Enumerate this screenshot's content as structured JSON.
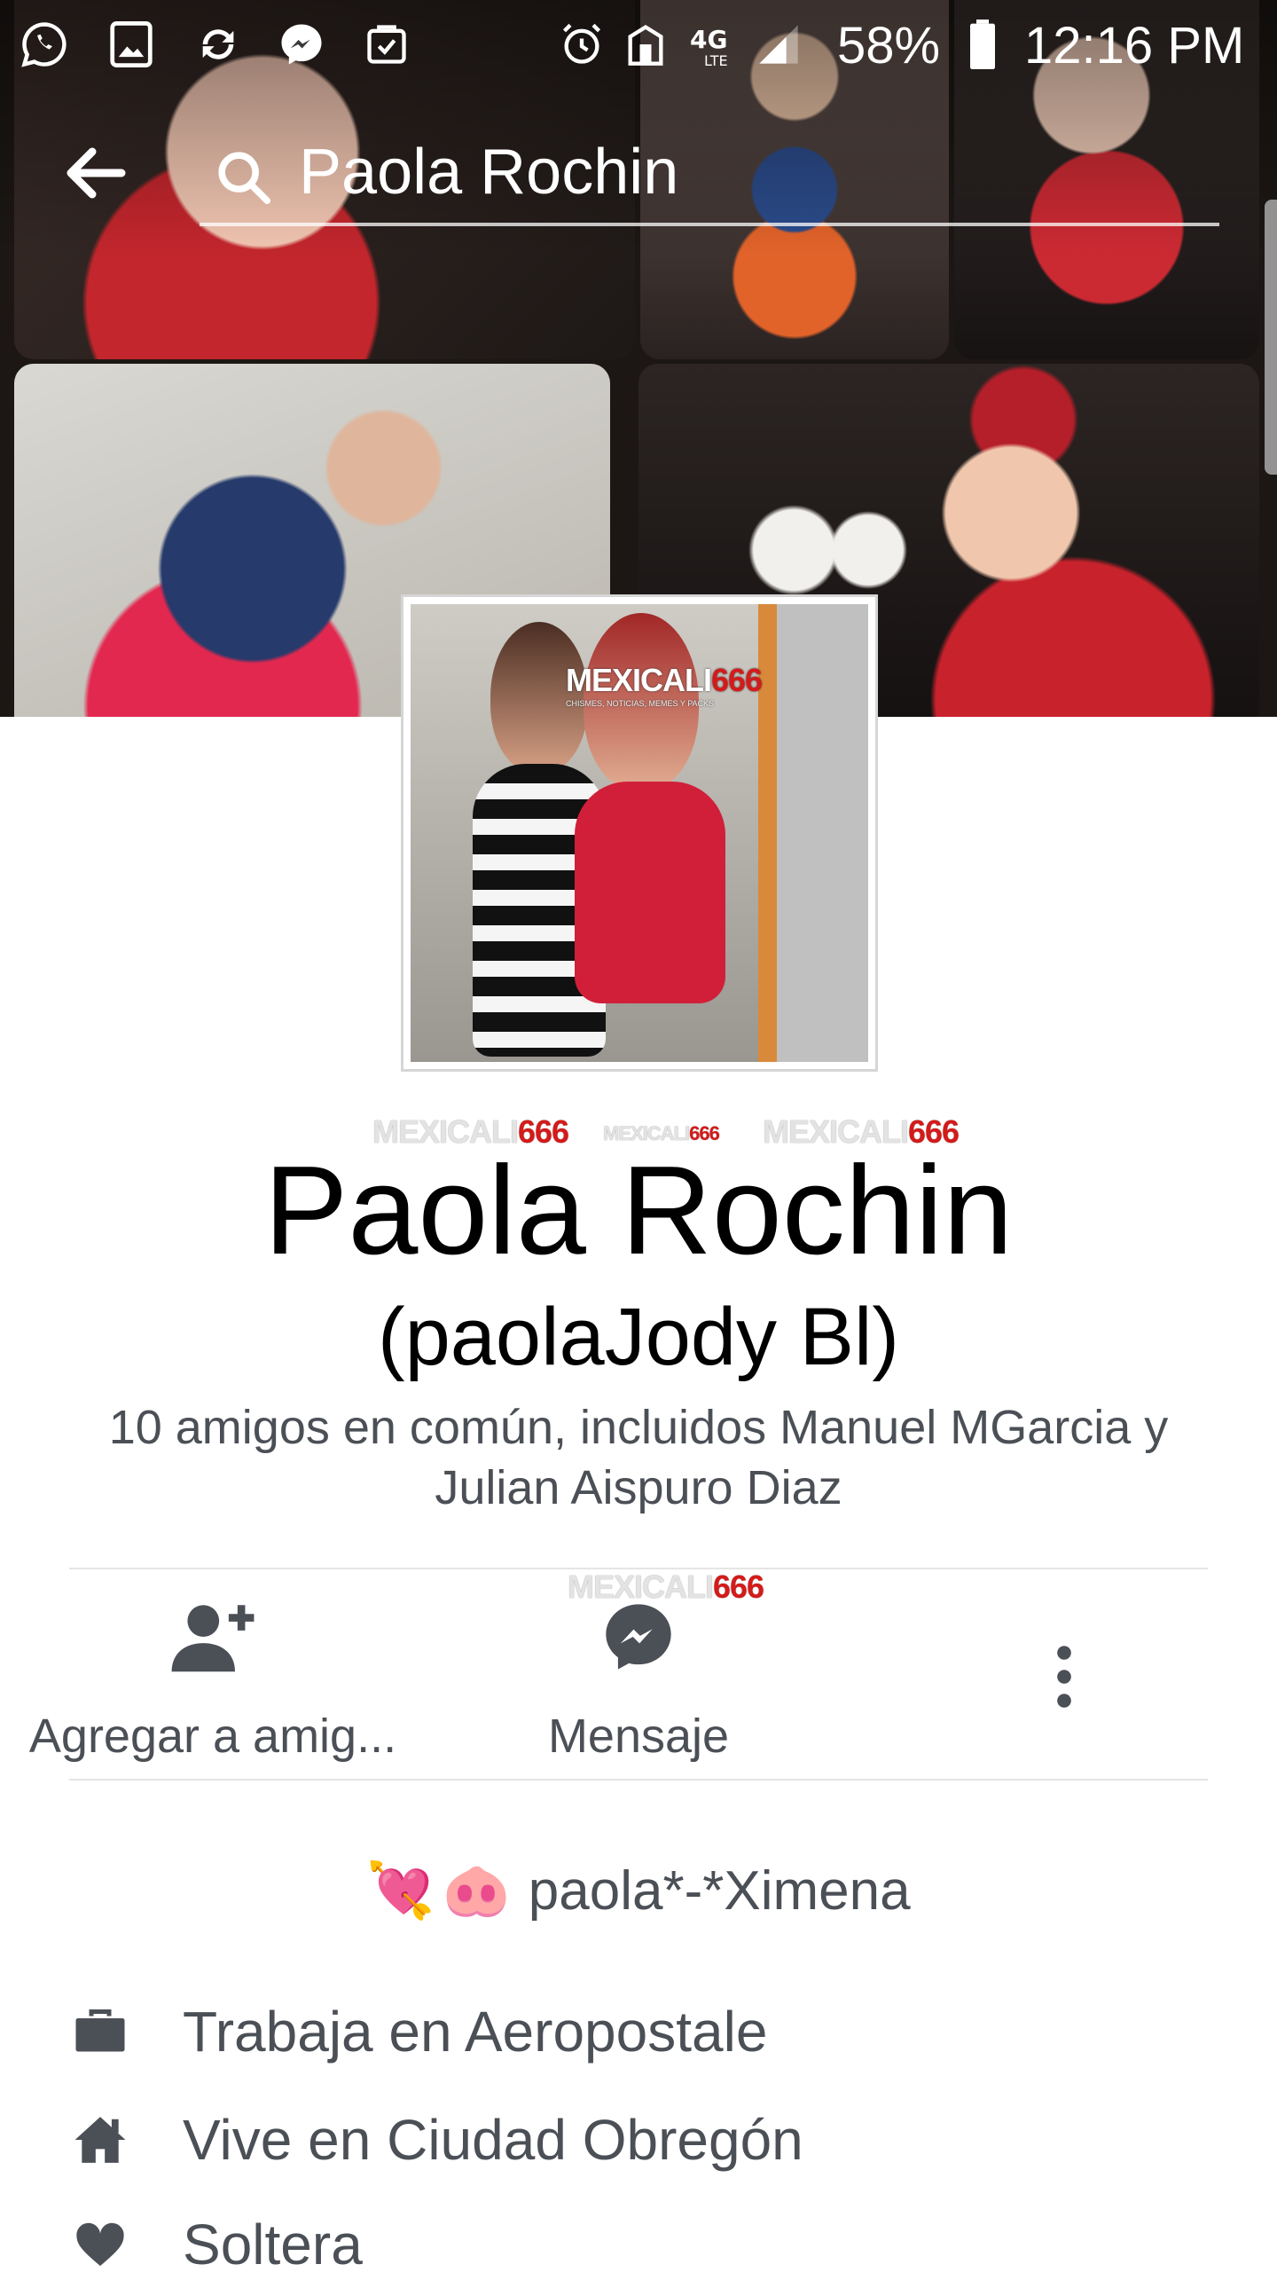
{
  "status_bar": {
    "battery_percent": "58%",
    "time": "12:16 PM",
    "network": "4G LTE",
    "left_icons": [
      "whatsapp-icon",
      "gallery-icon",
      "sync-icon",
      "messenger-icon",
      "clipboard-icon"
    ],
    "right_icons": [
      "alarm-icon",
      "signal-booster-icon",
      "4g-lte-icon",
      "signal-icon",
      "battery-icon"
    ]
  },
  "header": {
    "search_text": "Paola Rochin"
  },
  "watermark": {
    "brand_white": "MEXICALI",
    "brand_red": "666",
    "tagline": "CHISMES, NOTICIAS, MEMES Y PACKS"
  },
  "profile": {
    "name": "Paola Rochin",
    "alternate_name": "(paolaJody Bl)",
    "mutual_friends": "10 amigos en común, incluidos Manuel MGarcia y Julian Aispuro Diaz"
  },
  "actions": {
    "add_friend_label": "Agregar a amig...",
    "message_label": "Mensaje"
  },
  "bio": {
    "emojis": [
      "💘",
      "🐽"
    ],
    "text": "paola*-*Ximena"
  },
  "details": [
    {
      "icon": "briefcase-icon",
      "text": "Trabaja en Aeropostale"
    },
    {
      "icon": "home-icon",
      "text": "Vive en Ciudad Obregón"
    },
    {
      "icon": "heart-icon",
      "text": "Soltera"
    }
  ],
  "colors": {
    "text_secondary": "#4b4f56",
    "divider": "#e5e5e5",
    "watermark_red": "#d41a1a"
  }
}
